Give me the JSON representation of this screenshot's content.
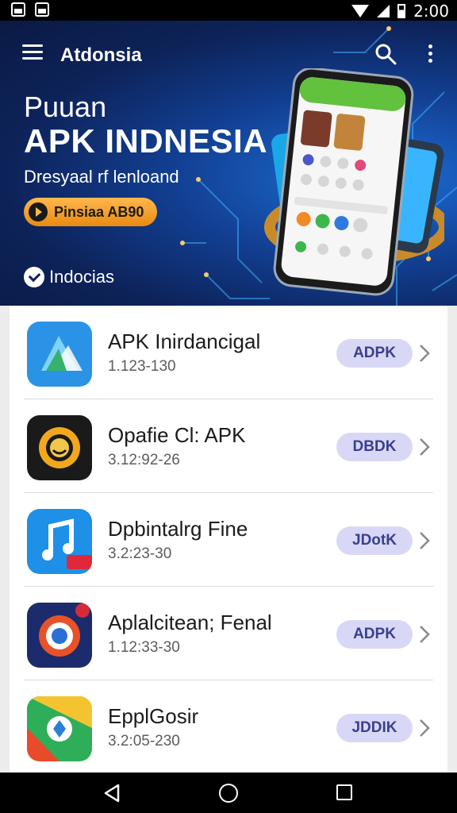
{
  "status_bar": {
    "time": "2:00"
  },
  "header": {
    "app_title": "Atdonsia"
  },
  "hero": {
    "kicker": "Puuan",
    "title": "APK INDNESIA",
    "subtitle": "Dresyaal rf lenloand",
    "cta_label": "Pinsiaa AB90",
    "brand_label": "Indocias"
  },
  "apps": [
    {
      "name": "APK Inirdancigal",
      "meta": "1.123-130",
      "action": "ADPK"
    },
    {
      "name": "Opafie Cl: APK",
      "meta": "3.12:92-26",
      "action": "DBDK"
    },
    {
      "name": "Dpbintalrg Fine",
      "meta": "3.2:23-30",
      "action": "JDotK"
    },
    {
      "name": "Aplalcitean; Fenal",
      "meta": "1.12:33-30",
      "action": "ADPK"
    },
    {
      "name": "EpplGosir",
      "meta": "3.2:05-230",
      "action": "JDDIK"
    }
  ],
  "colors": {
    "hero_dark": "#0a1a44",
    "hero_accent": "#1d6fd8",
    "pill_bg": "#d8d8f6",
    "pill_text": "#3a3f8f",
    "cta": "#f0a02a"
  }
}
